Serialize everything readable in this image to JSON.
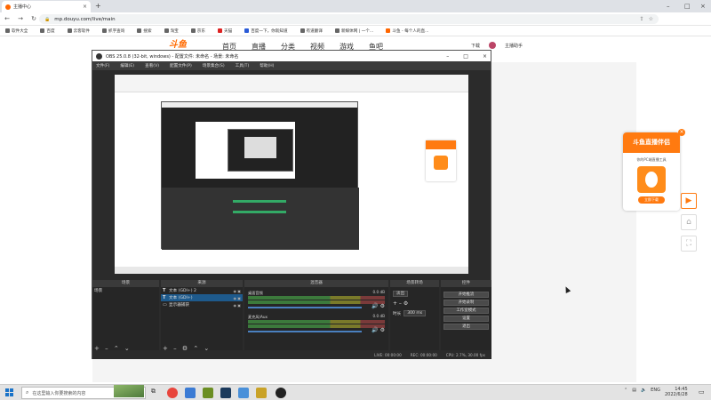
{
  "browser": {
    "tab_title": "主播中心",
    "url": "mp.douyu.com/live/main",
    "bookmarks": [
      "软件大全",
      "百度",
      "云客软件",
      "抓字查询",
      "搜索",
      "淘宝",
      "京东",
      "天猫",
      "百度一下，你就知道",
      "有道翻译",
      "新媒体网 | 一个...",
      "斗鱼 - 每个人的直..."
    ]
  },
  "site": {
    "logo": "斗鱼",
    "nav": [
      "首页",
      "直播",
      "分类",
      "视频",
      "游戏",
      "鱼吧"
    ],
    "download": "下载",
    "username": "主播助手"
  },
  "ad": {
    "title": "斗鱼直播伴侣",
    "subtitle": "你的PC端直播工具",
    "button": "立即下载",
    "close": "×"
  },
  "obs": {
    "title": "OBS 25.0.8 (32-bit, windows) - 配置文件: 未命名 - 场景: 未命名",
    "menu": [
      "文件(F)",
      "编辑(E)",
      "查看(V)",
      "配置文件(P)",
      "场景集合(S)",
      "工具(T)",
      "帮助(H)"
    ],
    "docks": {
      "scenes": "场景",
      "sources": "来源",
      "mixer": "混音器",
      "transitions": "场景转场",
      "controls": "控件"
    },
    "scenes": [
      "场景"
    ],
    "sources": [
      {
        "name": "文本 (GDI+) 2",
        "icon": "T",
        "selected": false
      },
      {
        "name": "文本 (GDI+)",
        "icon": "T",
        "selected": true
      },
      {
        "name": "显示器捕获",
        "icon": "▭",
        "selected": false
      }
    ],
    "mixer": [
      {
        "name": "桌面音频",
        "db": "0.0 dB"
      },
      {
        "name": "麦克风/Aux",
        "db": "0.0 dB"
      }
    ],
    "transition": {
      "type": "淡出",
      "duration_label": "时长",
      "duration": "300 ms"
    },
    "controls": [
      "开始推流",
      "开始录制",
      "工作室模式",
      "设置",
      "退出"
    ],
    "status": {
      "live": "LIVE: 00:00:00",
      "rec": "REC: 00:00:00",
      "cpu": "CPU: 2.7%, 30.00 fps"
    }
  },
  "taskbar": {
    "search_placeholder": "在这里输入你要搜索的内容",
    "lang": "ENG",
    "time": "14:45",
    "date": "2022/6/28"
  }
}
